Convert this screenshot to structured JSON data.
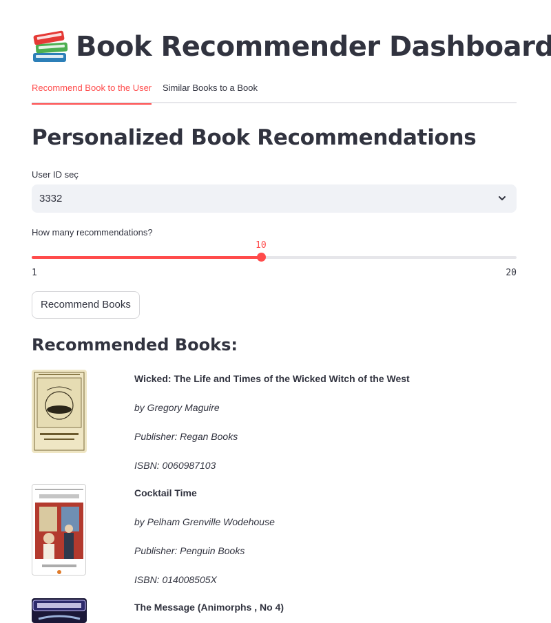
{
  "app": {
    "title": "Book Recommender Dashboard",
    "icon": "books-emoji-icon"
  },
  "tabs": [
    {
      "label": "Recommend Book to the User",
      "active": true
    },
    {
      "label": "Similar Books to a Book",
      "active": false
    }
  ],
  "section": {
    "heading": "Personalized Book Recommendations"
  },
  "user_select": {
    "label": "User ID seç",
    "value": "3332",
    "icon": "chevron-down-icon"
  },
  "slider": {
    "label": "How many recommendations?",
    "value": 10,
    "min": 1,
    "max": 20,
    "value_text": "10",
    "min_text": "1",
    "max_text": "20"
  },
  "recommend_button": {
    "label": "Recommend Books"
  },
  "results": {
    "heading": "Recommended Books:",
    "books": [
      {
        "title": "Wicked: The Life and Times of the Wicked Witch of the West",
        "author": "by Gregory Maguire",
        "publisher": "Publisher: Regan Books",
        "isbn": "ISBN: 0060987103"
      },
      {
        "title": "Cocktail Time",
        "author": "by Pelham Grenville Wodehouse",
        "publisher": "Publisher: Penguin Books",
        "isbn": "ISBN: 014008505X"
      },
      {
        "title": "The Message (Animorphs , No 4)",
        "author": "",
        "publisher": "",
        "isbn": ""
      }
    ]
  },
  "colors": {
    "accent": "#ff4b4b",
    "text": "#31333f",
    "input_bg": "#f0f2f6"
  }
}
